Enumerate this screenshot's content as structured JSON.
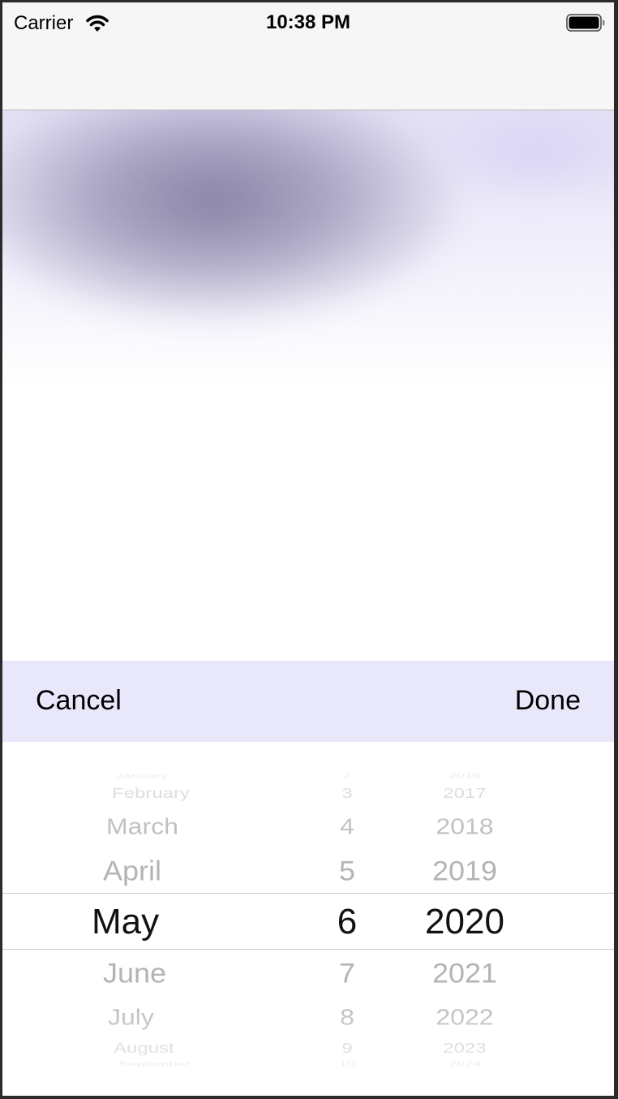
{
  "status_bar": {
    "carrier": "Carrier",
    "time": "10:38 PM",
    "wifi_icon": "wifi-icon",
    "battery_icon": "battery-icon"
  },
  "toolbar": {
    "cancel_label": "Cancel",
    "done_label": "Done",
    "background": "#e9e8fb"
  },
  "picker": {
    "months": [
      "January",
      "February",
      "March",
      "April",
      "May",
      "June",
      "July",
      "August",
      "September"
    ],
    "days": [
      "2",
      "3",
      "4",
      "5",
      "6",
      "7",
      "8",
      "9",
      "10"
    ],
    "years": [
      "2016",
      "2017",
      "2018",
      "2019",
      "2020",
      "2021",
      "2022",
      "2023",
      "2024"
    ],
    "selected": {
      "month": "May",
      "day": "6",
      "year": "2020"
    }
  }
}
